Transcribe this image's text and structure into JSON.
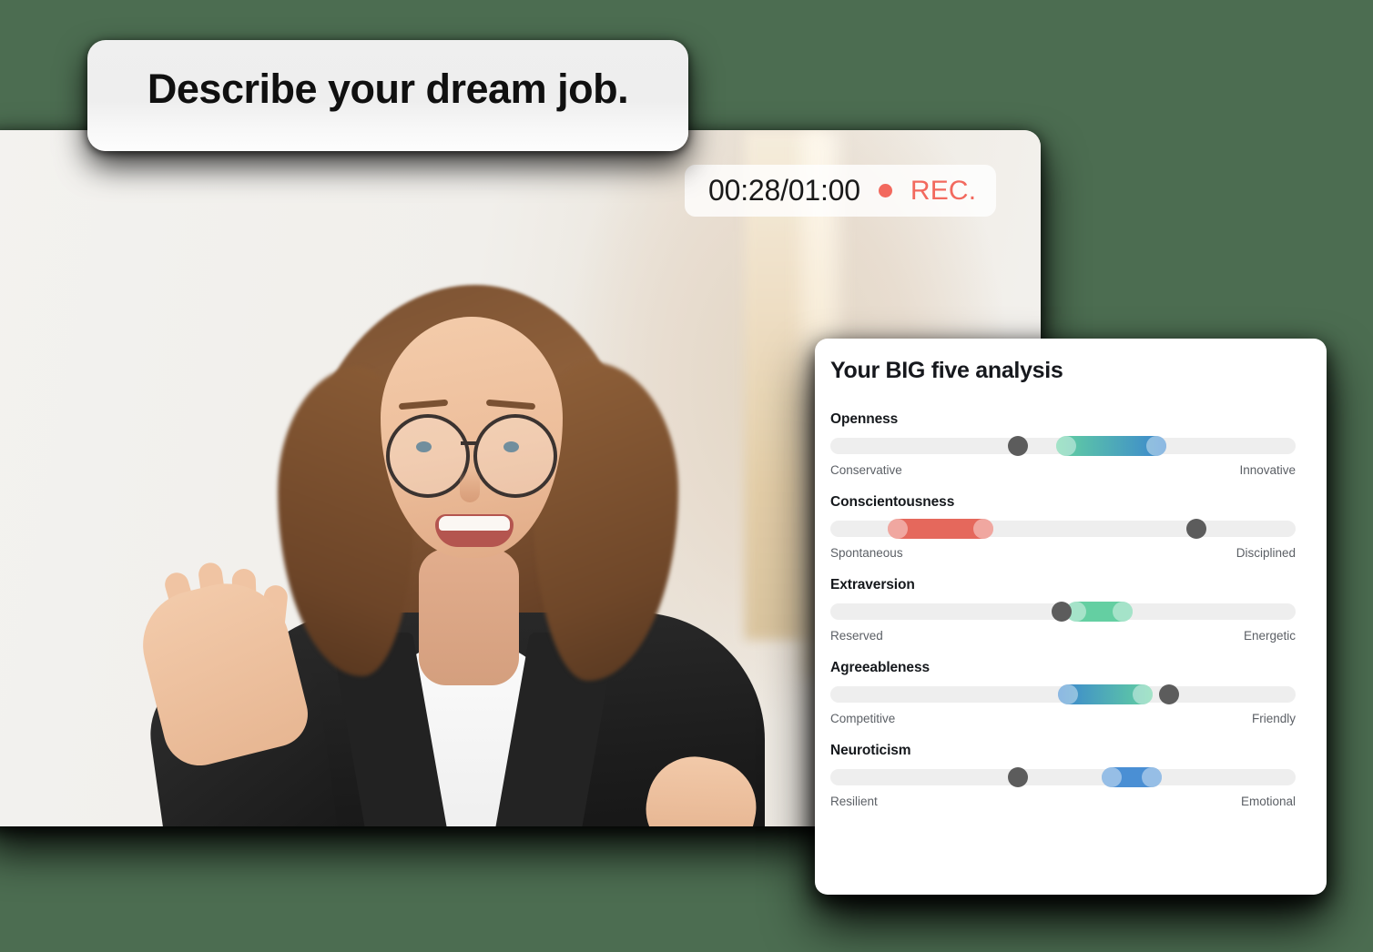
{
  "background": {
    "color": "#4c6d51"
  },
  "caption": {
    "text": "Describe your dream job."
  },
  "recording": {
    "time": "00:28/01:00",
    "label": "REC.",
    "dot_color": "#f2695e",
    "label_color": "#f2695e"
  },
  "analysis": {
    "title": "Your BIG five analysis",
    "traits": [
      {
        "name": "Openness",
        "left_label": "Conservative",
        "right_label": "Innovative",
        "marker_pct": 40.4,
        "range_start_pct": 48.6,
        "range_end_pct": 72.2,
        "gradient_from": "#62d0a0",
        "gradient_to": "#3b86cf"
      },
      {
        "name": "Conscientousness",
        "left_label": "Spontaneous",
        "right_label": "Disciplined",
        "marker_pct": 78.6,
        "range_start_pct": 12.4,
        "range_end_pct": 35.0,
        "gradient_from": "#e5685c",
        "gradient_to": "#e5685c"
      },
      {
        "name": "Extraversion",
        "left_label": "Reserved",
        "right_label": "Energetic",
        "marker_pct": 49.8,
        "range_start_pct": 50.6,
        "range_end_pct": 64.9,
        "gradient_from": "#64cfa2",
        "gradient_to": "#64cfa2"
      },
      {
        "name": "Agreeableness",
        "left_label": "Competitive",
        "right_label": "Friendly",
        "marker_pct": 72.8,
        "range_start_pct": 49.0,
        "range_end_pct": 69.2,
        "gradient_from": "#3b86cf",
        "gradient_to": "#62d0a0"
      },
      {
        "name": "Neuroticism",
        "left_label": "Resilient",
        "right_label": "Emotional",
        "marker_pct": 40.4,
        "range_start_pct": 58.4,
        "range_end_pct": 71.2,
        "gradient_from": "#4a8fd4",
        "gradient_to": "#4a8fd4"
      }
    ]
  }
}
